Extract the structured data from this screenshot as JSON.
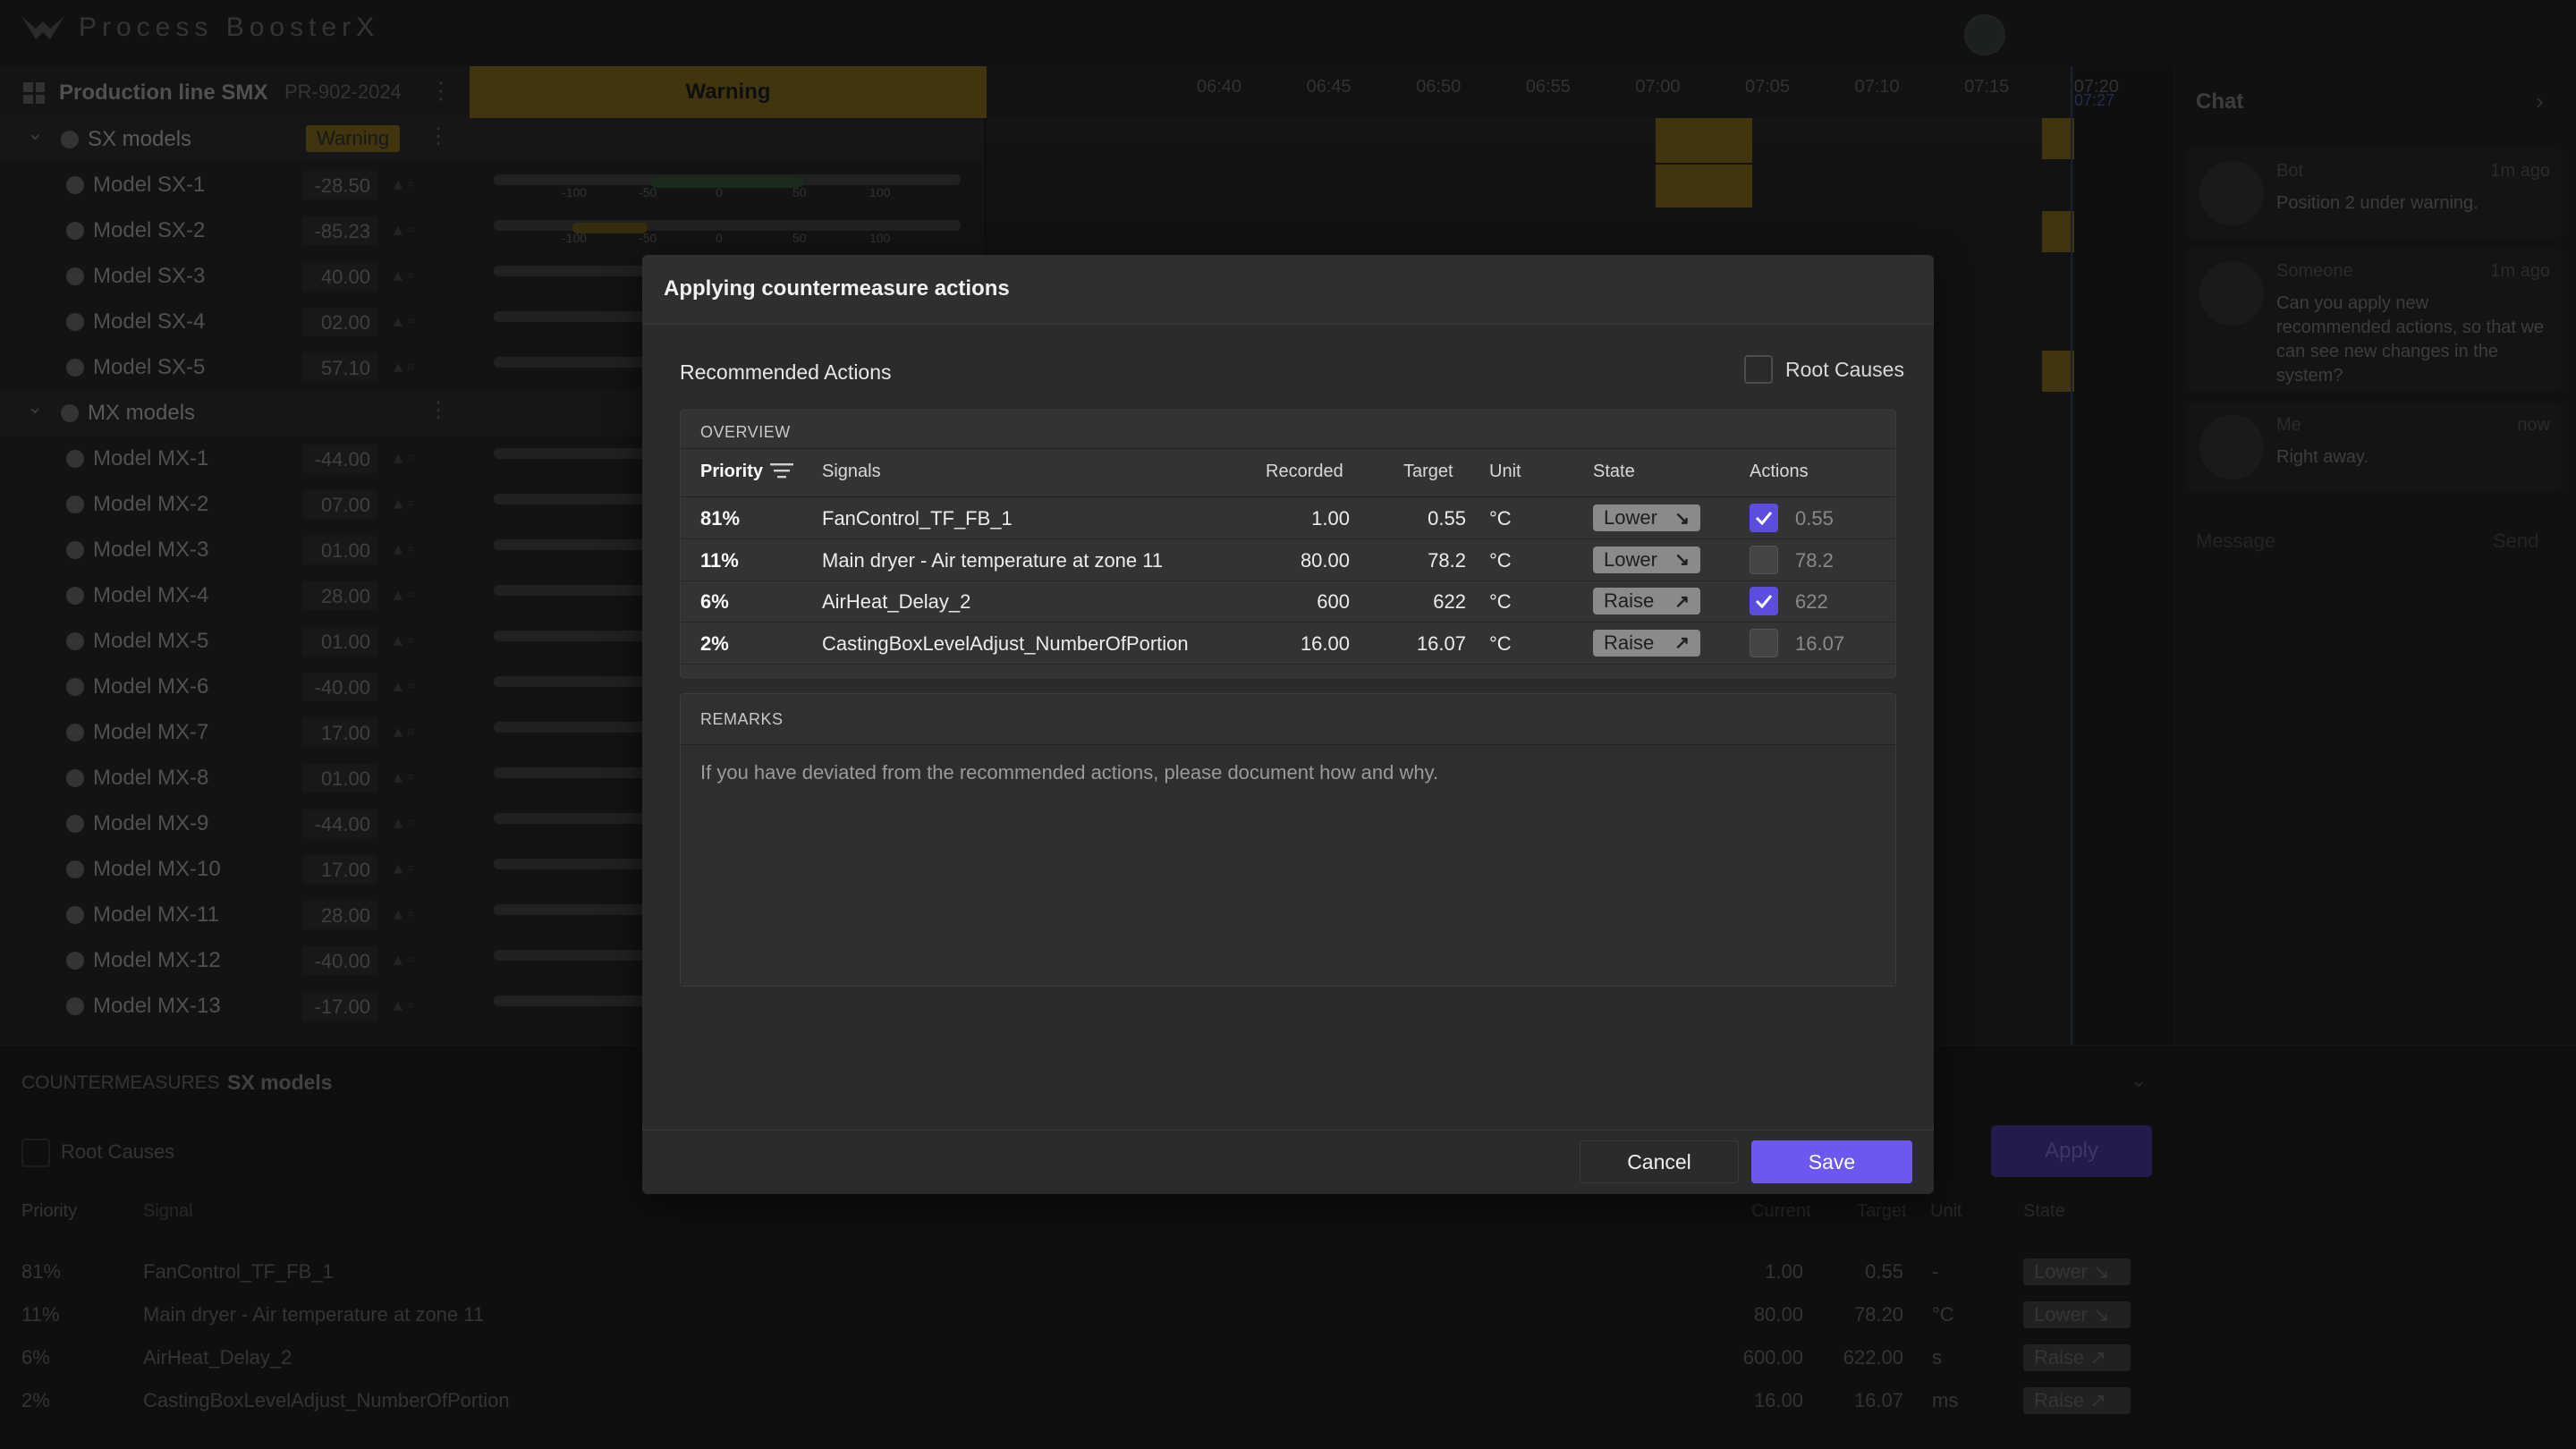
{
  "header": {
    "app_name": "Process BoosterX"
  },
  "production": {
    "title": "Production line SMX",
    "id": "PR-902-2024",
    "status": "Warning"
  },
  "timeline_ticks": [
    "06:40",
    "06:45",
    "06:50",
    "06:55",
    "07:00",
    "07:05",
    "07:10",
    "07:15",
    "07:20"
  ],
  "current_time": "07:27",
  "tree": {
    "groups": [
      {
        "label": "SX models",
        "badge": "Warning"
      },
      {
        "label": "MX models"
      }
    ],
    "sx": [
      {
        "name": "Model SX-1",
        "value": "-28.50"
      },
      {
        "name": "Model SX-2",
        "value": "-85.23"
      },
      {
        "name": "Model SX-3",
        "value": "40.00"
      },
      {
        "name": "Model SX-4",
        "value": "02.00"
      },
      {
        "name": "Model SX-5",
        "value": "57.10"
      }
    ],
    "mx": [
      {
        "name": "Model MX-1",
        "value": "-44.00"
      },
      {
        "name": "Model MX-2",
        "value": "07.00"
      },
      {
        "name": "Model MX-3",
        "value": "01.00"
      },
      {
        "name": "Model MX-4",
        "value": "28.00"
      },
      {
        "name": "Model MX-5",
        "value": "01.00"
      },
      {
        "name": "Model MX-6",
        "value": "-40.00"
      },
      {
        "name": "Model MX-7",
        "value": "17.00"
      },
      {
        "name": "Model MX-8",
        "value": "01.00"
      },
      {
        "name": "Model MX-9",
        "value": "-44.00"
      },
      {
        "name": "Model MX-10",
        "value": "17.00"
      },
      {
        "name": "Model MX-11",
        "value": "28.00"
      },
      {
        "name": "Model MX-12",
        "value": "-40.00"
      },
      {
        "name": "Model MX-13",
        "value": "-17.00"
      }
    ],
    "scale": [
      "-100",
      "-50",
      "0",
      "50",
      "100"
    ]
  },
  "chat": {
    "title": "Chat",
    "messages": [
      {
        "who": "Bot",
        "time": "1m ago",
        "text": "Position 2 under warning."
      },
      {
        "who": "Someone",
        "time": "1m ago",
        "text": "Can you apply new recommended actions, so that we can see new changes in the system?"
      },
      {
        "who": "Me",
        "time": "now",
        "text": "Right away."
      }
    ],
    "placeholder": "Message",
    "send": "Send"
  },
  "bottom": {
    "section": "COUNTERMEASURES",
    "model": "SX models",
    "root_causes": "Root Causes",
    "apply": "Apply",
    "headers": {
      "priority": "Priority",
      "signal": "Signal",
      "current": "Current",
      "target": "Target",
      "unit": "Unit",
      "state": "State"
    },
    "rows": [
      {
        "priority": "81%",
        "signal": "FanControl_TF_FB_1",
        "current": "1.00",
        "target": "0.55",
        "unit": "-",
        "state": "Lower"
      },
      {
        "priority": "11%",
        "signal": "Main dryer - Air temperature at zone 11",
        "current": "80.00",
        "target": "78.20",
        "unit": "°C",
        "state": "Lower"
      },
      {
        "priority": "6%",
        "signal": "AirHeat_Delay_2",
        "current": "600.00",
        "target": "622.00",
        "unit": "s",
        "state": "Raise"
      },
      {
        "priority": "2%",
        "signal": "CastingBoxLevelAdjust_NumberOfPortion",
        "current": "16.00",
        "target": "16.07",
        "unit": "ms",
        "state": "Raise"
      }
    ]
  },
  "modal": {
    "title": "Applying countermeasure actions",
    "recommended_label": "Recommended Actions",
    "root_causes_label": "Root Causes",
    "overview_label": "OVERVIEW",
    "headers": {
      "priority": "Priority",
      "signals": "Signals",
      "recorded": "Recorded",
      "target": "Target",
      "unit": "Unit",
      "state": "State",
      "actions": "Actions"
    },
    "rows": [
      {
        "priority": "81%",
        "signal": "FanControl_TF_FB_1",
        "recorded": "1.00",
        "target": "0.55",
        "unit": "°C",
        "state": "Lower",
        "checked": true,
        "action_value": "0.55"
      },
      {
        "priority": "11%",
        "signal": "Main dryer - Air temperature at zone 11",
        "recorded": "80.00",
        "target": "78.2",
        "unit": "°C",
        "state": "Lower",
        "checked": false,
        "action_value": "78.2"
      },
      {
        "priority": "6%",
        "signal": "AirHeat_Delay_2",
        "recorded": "600",
        "target": "622",
        "unit": "°C",
        "state": "Raise",
        "checked": true,
        "action_value": "622"
      },
      {
        "priority": "2%",
        "signal": "CastingBoxLevelAdjust_NumberOfPortion",
        "recorded": "16.00",
        "target": "16.07",
        "unit": "°C",
        "state": "Raise",
        "checked": false,
        "action_value": "16.07"
      }
    ],
    "remarks_label": "REMARKS",
    "remarks_placeholder": "If you have deviated from the recommended actions, please document how and why.",
    "cancel": "Cancel",
    "save": "Save"
  }
}
